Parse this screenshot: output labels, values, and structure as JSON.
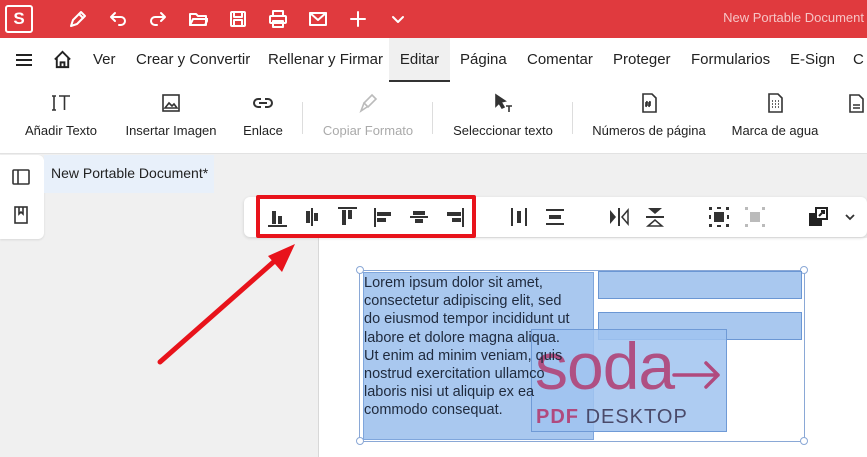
{
  "app": {
    "logo_letter": "S",
    "window_title": "New Portable Document"
  },
  "menu": {
    "items": [
      "Ver",
      "Crear y Convertir",
      "Rellenar y Firmar",
      "Editar",
      "Página",
      "Comentar",
      "Proteger",
      "Formularios",
      "E-Sign",
      "C"
    ],
    "active": "Editar"
  },
  "ribbon": {
    "tools": [
      {
        "label": "Añadir Texto",
        "icon": "text-insert-icon"
      },
      {
        "label": "Insertar Imagen",
        "icon": "image-icon"
      },
      {
        "label": "Enlace",
        "icon": "link-icon"
      },
      {
        "label": "Copiar Formato",
        "icon": "format-brush-icon",
        "disabled": true
      },
      {
        "label": "Seleccionar texto",
        "icon": "text-select-icon"
      },
      {
        "label": "Números de página",
        "icon": "page-number-icon"
      },
      {
        "label": "Marca de agua",
        "icon": "watermark-icon"
      }
    ]
  },
  "document": {
    "tab_title": "New Portable Document*",
    "text_lines": [
      "Lorem ipsum dolor sit amet,",
      "consectetur adipiscing elit, sed",
      "do eiusmod tempor incididunt ut",
      "labore et dolore magna aliqua.",
      "Ut enim ad minim veniam, quis",
      "nostrud exercitation ullamco",
      "laboris nisi ut aliquip ex ea",
      "commodo consequat."
    ],
    "logo_word": "soda",
    "logo_pdf": "PDF",
    "logo_desktop": "DESKTOP"
  },
  "colors": {
    "brand_red": "#e03a3e",
    "highlight": "#e8131b",
    "selection_blue": "#a9c8ef",
    "logo_magenta": "#b04a7e"
  }
}
